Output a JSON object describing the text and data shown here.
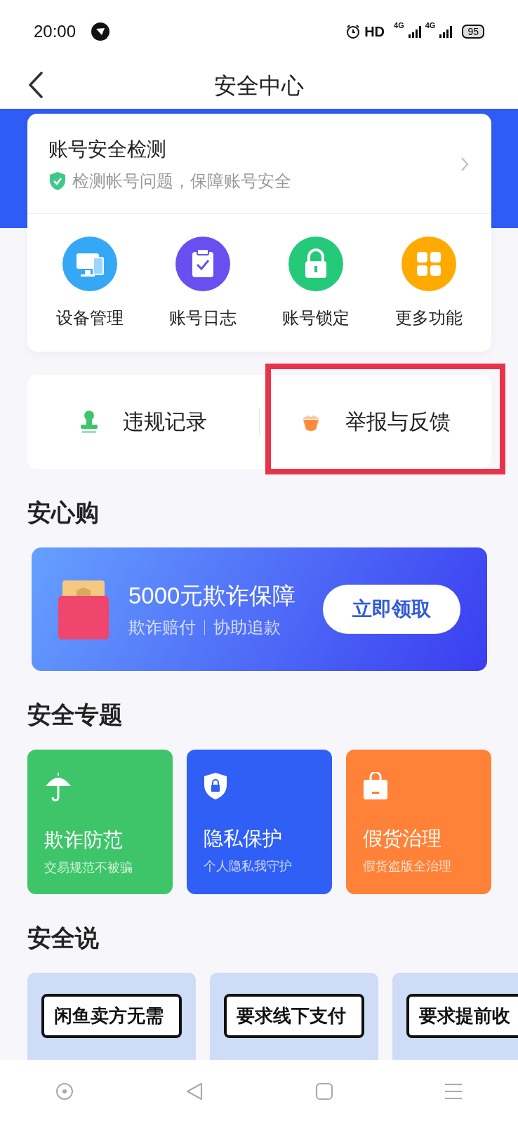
{
  "status_bar": {
    "time": "20:00",
    "hd": "HD",
    "networks": [
      "4G",
      "4G"
    ],
    "battery": "95"
  },
  "header": {
    "title": "安全中心"
  },
  "account_check": {
    "title": "账号安全检测",
    "subtitle": "检测帐号问题，保障账号安全"
  },
  "quick_actions": [
    {
      "label": "设备管理",
      "kind": "devices",
      "color": "#35a8f5"
    },
    {
      "label": "账号日志",
      "kind": "log",
      "color": "#6a4ff0"
    },
    {
      "label": "账号锁定",
      "kind": "lock",
      "color": "#25c97a"
    },
    {
      "label": "更多功能",
      "kind": "grid",
      "color": "#ffaa00"
    }
  ],
  "records": [
    {
      "label": "违规记录",
      "kind": "stamp",
      "highlighted": false
    },
    {
      "label": "举报与反馈",
      "kind": "report",
      "highlighted": true
    }
  ],
  "anxin": {
    "heading": "安心购",
    "banner": {
      "title": "5000元欺诈保障",
      "tags": [
        "欺诈赔付",
        "协助追款"
      ],
      "button": "立即领取"
    }
  },
  "topics": {
    "heading": "安全专题",
    "cards": [
      {
        "title": "欺诈防范",
        "subtitle": "交易规范不被骗",
        "kind": "umbrella",
        "color": "#3ec56a"
      },
      {
        "title": "隐私保护",
        "subtitle": "个人隐私我守护",
        "kind": "shield",
        "color": "#2f5ff5"
      },
      {
        "title": "假货治理",
        "subtitle": "假货盗版全治理",
        "kind": "bag",
        "color": "#ff8238"
      }
    ]
  },
  "talk": {
    "heading": "安全说",
    "cards": [
      "闲鱼卖方无需",
      "要求线下支付",
      "要求提前收"
    ]
  }
}
